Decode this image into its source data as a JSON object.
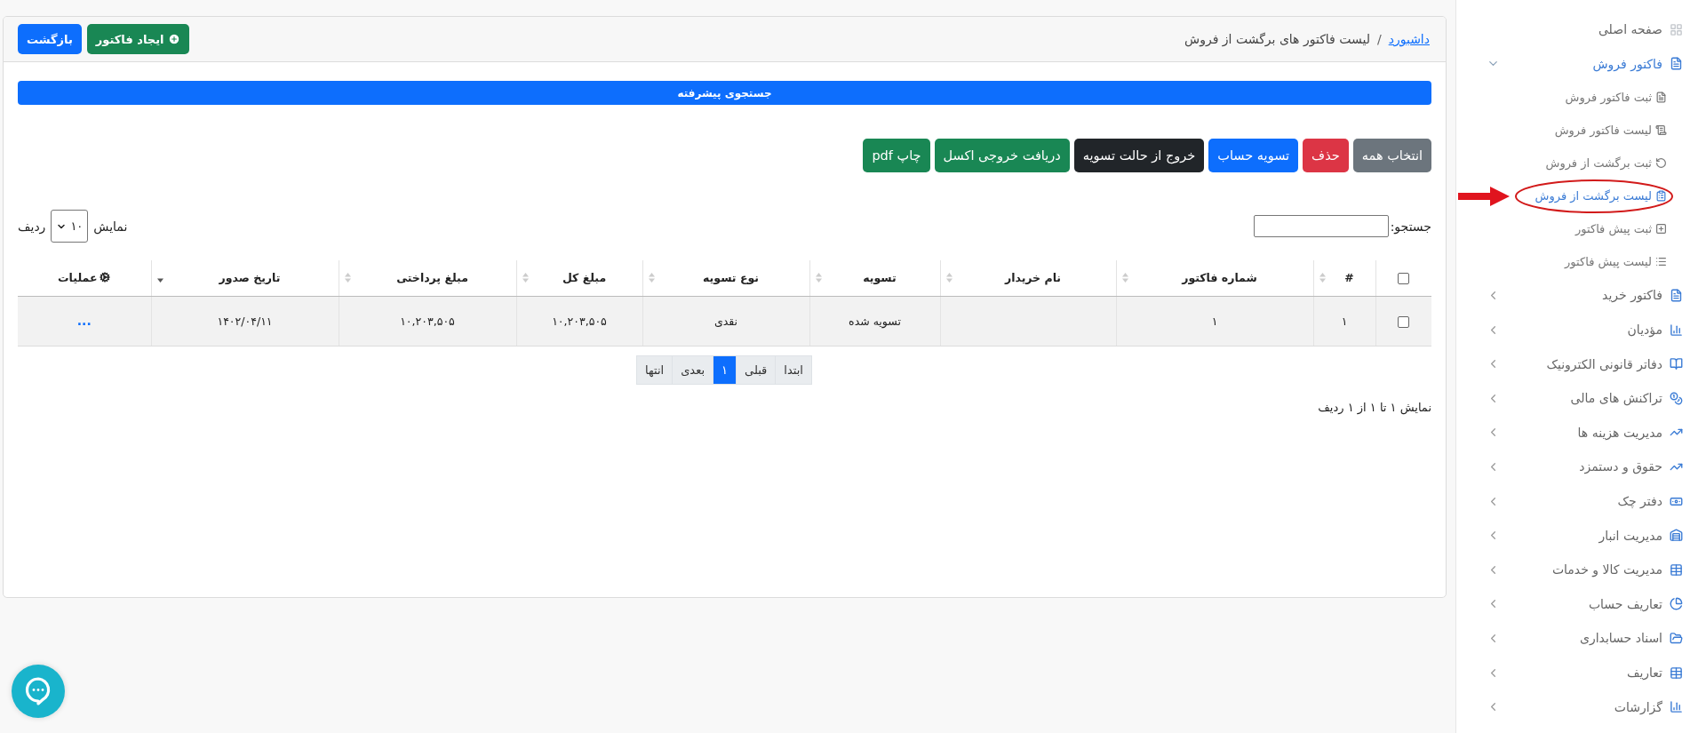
{
  "header": {
    "breadcrumb": [
      {
        "label": "داشبورد",
        "link": true
      },
      {
        "label": "لیست فاکتور های برگشت از فروش",
        "link": false
      }
    ],
    "separator": "/",
    "buttons": [
      {
        "label": "ایجاد فاکتور",
        "kind": "create"
      },
      {
        "label": "بازگشت",
        "kind": "back"
      }
    ]
  },
  "advanced_search": {
    "label": "جستجوی پیشرفته"
  },
  "actions": [
    {
      "label": "انتخاب همه",
      "color": "#6c757d"
    },
    {
      "label": "حذف",
      "color": "#dc3545"
    },
    {
      "label": "تسویه حساب",
      "color": "#0d6efd"
    },
    {
      "label": "خروج از حالت تسویه",
      "color": "#212529"
    },
    {
      "label": "دریافت خروجی اکسل",
      "color": "#198754"
    },
    {
      "label": "چاپ pdf",
      "color": "#198754"
    }
  ],
  "search": {
    "label": "جستجو:"
  },
  "page_length": {
    "prefix": "نمایش",
    "value": "۱۰",
    "suffix": "ردیف"
  },
  "table": {
    "select_all": {
      "checked": false
    },
    "columns": [
      {
        "kind": "text",
        "label": "#",
        "sorted": false
      },
      {
        "kind": "text",
        "label": "شماره فاکتور",
        "sorted": false
      },
      {
        "kind": "text",
        "label": "نام خریدار",
        "sorted": false
      },
      {
        "kind": "text",
        "label": "تسویه",
        "sorted": false
      },
      {
        "kind": "text",
        "label": "نوع تسویه",
        "sorted": false
      },
      {
        "kind": "text",
        "label": "مبلغ کل",
        "sorted": false
      },
      {
        "kind": "text",
        "label": "مبلغ پرداختی",
        "sorted": false
      },
      {
        "kind": "text",
        "label": "تاریخ صدور",
        "sorted": true
      },
      {
        "kind": "actions",
        "label": "عملیات"
      }
    ],
    "rows": [
      {
        "checked": false,
        "cells": [
          "۱",
          "۱",
          null,
          "تسویه شده",
          "نقدی",
          "۱۰,۲۰۳,۵۰۵",
          "۱۰,۲۰۳,۵۰۵",
          "۱۴۰۲/۰۴/۱۱",
          "..."
        ]
      }
    ]
  },
  "pagination": [
    {
      "label": "ابتدا",
      "selected": false
    },
    {
      "label": "قبلی",
      "selected": false
    },
    {
      "label": "۱",
      "selected": true
    },
    {
      "label": "بعدی",
      "selected": false
    },
    {
      "label": "انتها",
      "selected": false
    }
  ],
  "info": "نمایش ۱ تا ۱ از ۱ ردیف",
  "sidebar": {
    "items": [
      {
        "kind": "link",
        "label": "صفحه اصلی"
      },
      {
        "kind": "group",
        "label": "فاکتور فروش",
        "expanded": true,
        "children": [
          {
            "label": "ثبت فاکتور فروش",
            "selected": false
          },
          {
            "label": "لیست فاکتور فروش",
            "selected": false
          },
          {
            "label": "ثبت برگشت از فروش",
            "selected": false
          },
          {
            "label": "لیست برگشت از فروش",
            "selected": true
          },
          {
            "label": "ثبت پیش فاکتور",
            "selected": false
          },
          {
            "label": "لیست پیش فاکتور",
            "selected": false
          }
        ]
      },
      {
        "kind": "group",
        "label": "فاکتور خرید",
        "expanded": false
      },
      {
        "kind": "group",
        "label": "مؤدیان",
        "expanded": false
      },
      {
        "kind": "group",
        "label": "دفاتر قانونی الکترونیک",
        "expanded": false
      },
      {
        "kind": "group",
        "label": "تراکنش های مالی",
        "expanded": false
      },
      {
        "kind": "group",
        "label": "مدیریت هزینه ها",
        "expanded": false
      },
      {
        "kind": "group",
        "label": "حقوق و دستمزد",
        "expanded": false
      },
      {
        "kind": "group",
        "label": "دفتر چک",
        "expanded": false
      },
      {
        "kind": "group",
        "label": "مدیریت انبار",
        "expanded": false
      },
      {
        "kind": "group",
        "label": "مدیریت کالا و خدمات",
        "expanded": false
      },
      {
        "kind": "group",
        "label": "تعاریف حساب",
        "expanded": false
      },
      {
        "kind": "group",
        "label": "اسناد حسابداری",
        "expanded": false
      },
      {
        "kind": "group",
        "label": "تعاریف",
        "expanded": false
      },
      {
        "kind": "group",
        "label": "گزارشات",
        "expanded": false
      }
    ]
  }
}
